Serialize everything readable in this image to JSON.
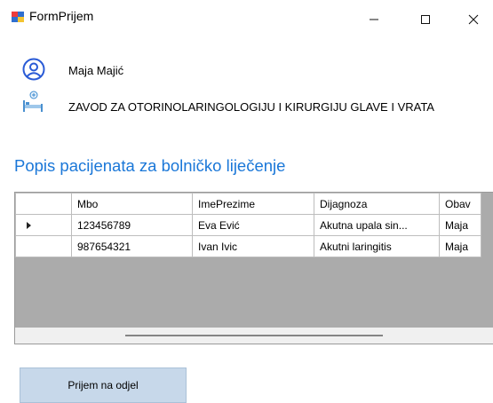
{
  "window": {
    "title": "FormPrijem",
    "icon": "form-app-icon",
    "controls": [
      "minimize-icon",
      "maximize-icon",
      "close-icon"
    ]
  },
  "user": {
    "name": "Maja Majić",
    "icon": "user-circle-icon"
  },
  "department": {
    "name": "ZAVOD ZA OTORINOLARINGOLOGIJU I KIRURGIJU GLAVE I VRATA",
    "icon": "hospital-bed-icon"
  },
  "heading": "Popis pacijenata za bolničko liječenje",
  "grid": {
    "columns": [
      "Mbo",
      "ImePrezime",
      "Dijagnoza",
      "Obav"
    ],
    "rows": [
      {
        "selected": true,
        "cells": [
          "123456789",
          "Eva Ević",
          "Akutna upala sin...",
          "Maja"
        ]
      },
      {
        "selected": false,
        "cells": [
          "987654321",
          "Ivan Ivic",
          "Akutni laringitis",
          "Maja"
        ]
      }
    ]
  },
  "actions": {
    "admit_label": "Prijem na odjel"
  },
  "colors": {
    "heading": "#1a77d8",
    "grid_empty": "#ababab",
    "button": "#c7d8ea"
  }
}
